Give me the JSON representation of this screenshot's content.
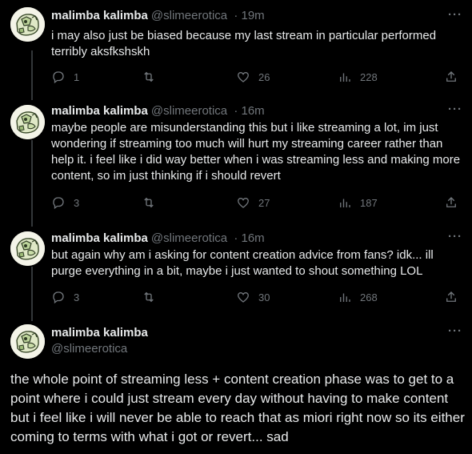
{
  "tweets": [
    {
      "name": "malimba kalimba",
      "handle": "@slimeerotica",
      "time": "19m",
      "text": "i may also just be biased because my last stream in particular performed terribly aksfkshskh",
      "replies": "1",
      "retweets": "",
      "likes": "26",
      "views": "228"
    },
    {
      "name": "malimba kalimba",
      "handle": "@slimeerotica",
      "time": "16m",
      "text": "maybe people are misunderstanding this but i like streaming a lot, im just wondering if streaming too much will hurt my streaming career rather than help it. i feel like i did way better when i was streaming less and making more content, so im just thinking if i should revert",
      "replies": "3",
      "retweets": "",
      "likes": "27",
      "views": "187"
    },
    {
      "name": "malimba kalimba",
      "handle": "@slimeerotica",
      "time": "16m",
      "text": "but again why am i asking for content creation advice from fans? idk... ill purge everything in a bit, maybe i just wanted to shout something LOL",
      "replies": "3",
      "retweets": "",
      "likes": "30",
      "views": "268"
    }
  ],
  "main_tweet": {
    "name": "malimba kalimba",
    "handle": "@slimeerotica",
    "text": "the whole point of streaming less + content creation phase was to get to a point where i could just stream every day without having to make content but i feel like i will never be able to reach that as miori right now so its either coming to terms with what i got or revert... sad"
  },
  "separator": "·",
  "more_label": "···",
  "icons": {
    "reply": "reply-icon",
    "retweet": "retweet-icon",
    "like": "heart-icon",
    "views": "views-chart-icon",
    "share": "share-icon",
    "more": "more-icon"
  },
  "colors": {
    "background": "#000000",
    "text": "#e7e9ea",
    "secondary": "#71767b",
    "thread_line": "#333639"
  }
}
